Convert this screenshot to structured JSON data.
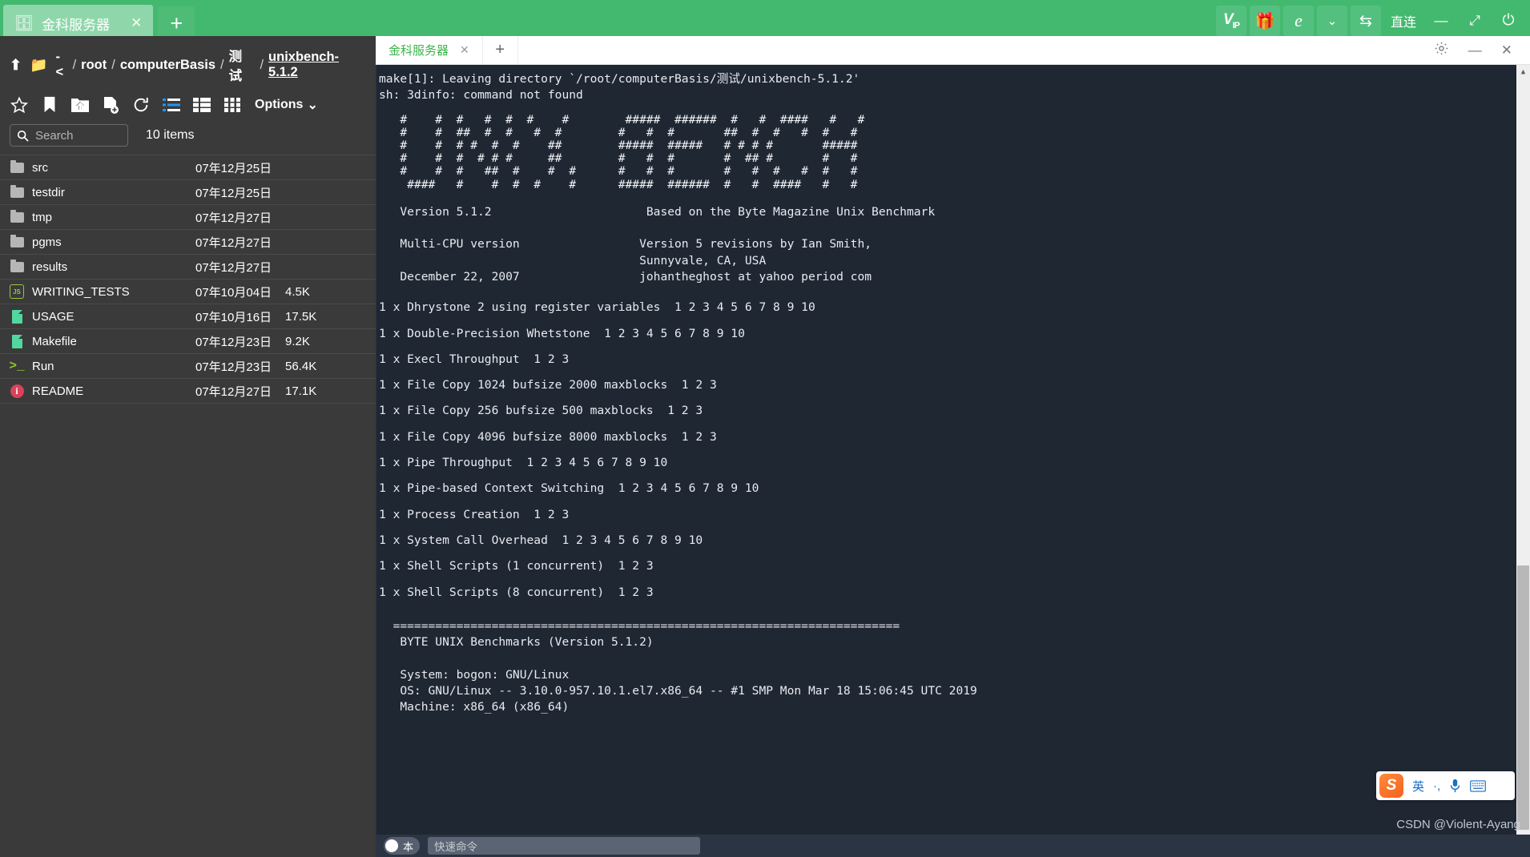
{
  "window": {
    "tab": {
      "label": "金科服务器",
      "icon": "server-icon",
      "close": "✕"
    },
    "new_tab": "+",
    "toolbar_right": [
      {
        "name": "vip-button",
        "label": "VIP"
      },
      {
        "name": "gift-button",
        "label": "🎁"
      },
      {
        "name": "ie-browser-button",
        "label": "e"
      },
      {
        "name": "chevron-down-button",
        "label": "⌄"
      },
      {
        "name": "transfer-button",
        "label": "⇆"
      },
      {
        "name": "direct-connect-button",
        "label": "直连"
      },
      {
        "name": "minimize-button",
        "label": "—"
      },
      {
        "name": "fullscreen-button",
        "label": "⤢"
      },
      {
        "name": "power-button",
        "label": "⏻"
      }
    ]
  },
  "filepane": {
    "path": {
      "up_icon": "⬆",
      "folder_icon": "📁",
      "crumbs": [
        "-<",
        "root",
        "computerBasis",
        "测试",
        "unixbench-5.1.2"
      ],
      "separator": "/"
    },
    "tools": [
      "star-icon",
      "bookmark-icon",
      "upload-folder-icon",
      "new-file-icon",
      "refresh-icon",
      "list-view-icon",
      "detail-view-icon",
      "grid-view-icon"
    ],
    "options_label": "Options",
    "options_caret": "⌄",
    "search": {
      "placeholder": "Search",
      "icon": "search-icon",
      "value": ""
    },
    "items_count": "10 items",
    "files": [
      {
        "icon": "folder",
        "name": "src",
        "date": "07年12月25日",
        "size": ""
      },
      {
        "icon": "folder",
        "name": "testdir",
        "date": "07年12月25日",
        "size": ""
      },
      {
        "icon": "folder",
        "name": "tmp",
        "date": "07年12月27日",
        "size": ""
      },
      {
        "icon": "folder",
        "name": "pgms",
        "date": "07年12月27日",
        "size": ""
      },
      {
        "icon": "folder",
        "name": "results",
        "date": "07年12月27日",
        "size": ""
      },
      {
        "icon": "js",
        "name": "WRITING_TESTS",
        "date": "07年10月04日",
        "size": "4.5K"
      },
      {
        "icon": "doc",
        "name": "USAGE",
        "date": "07年10月16日",
        "size": "17.5K"
      },
      {
        "icon": "doc",
        "name": "Makefile",
        "date": "07年12月23日",
        "size": "9.2K"
      },
      {
        "icon": "run",
        "name": "Run",
        "date": "07年12月23日",
        "size": "56.4K"
      },
      {
        "icon": "readme",
        "name": "README",
        "date": "07年12月27日",
        "size": "17.1K"
      }
    ]
  },
  "terminal": {
    "tab_label": "金科服务器",
    "tab_close": "✕",
    "new_tab": "+",
    "win_buttons": [
      {
        "name": "settings-gear-button",
        "label": "⚙"
      },
      {
        "name": "minimize-button",
        "label": "—"
      },
      {
        "name": "close-button",
        "label": "✕"
      }
    ],
    "header_lines": "make[1]: Leaving directory `/root/computerBasis/测试/unixbench-5.1.2'\nsh: 3dinfo: command not found",
    "ascii_art": "   #    #  #   #  #  #    #        #####  ######  #   #  ####   #   #\n   #    #  ##  #  #   #  #        #   #  #       ##  #  #   #  #   #\n   #    #  # #  #  #    ##        #####  #####   # # # #       #####\n   #    #  #  # # #     ##        #   #  #       #  ## #       #   #\n   #    #  #   ##  #    #  #      #   #  #       #   #  #   #  #   #\n    ####   #    #  #  #    #      #####  ######  #   #  ####   #   #",
    "version_block": "   Version 5.1.2                      Based on the Byte Magazine Unix Benchmark\n\n   Multi-CPU version                 Version 5 revisions by Ian Smith,\n                                     Sunnyvale, CA, USA\n   December 22, 2007                 johantheghost at yahoo period com",
    "test_lines": [
      "1 x Dhrystone 2 using register variables  1 2 3 4 5 6 7 8 9 10",
      "1 x Double-Precision Whetstone  1 2 3 4 5 6 7 8 9 10",
      "1 x Execl Throughput  1 2 3",
      "1 x File Copy 1024 bufsize 2000 maxblocks  1 2 3",
      "1 x File Copy 256 bufsize 500 maxblocks  1 2 3",
      "1 x File Copy 4096 bufsize 8000 maxblocks  1 2 3",
      "1 x Pipe Throughput  1 2 3 4 5 6 7 8 9 10",
      "1 x Pipe-based Context Switching  1 2 3 4 5 6 7 8 9 10",
      "1 x Process Creation  1 2 3",
      "1 x System Call Overhead  1 2 3 4 5 6 7 8 9 10",
      "1 x Shell Scripts (1 concurrent)  1 2 3",
      "1 x Shell Scripts (8 concurrent)  1 2 3"
    ],
    "footer_block": "  ========================================================================\n   BYTE UNIX Benchmarks (Version 5.1.2)\n\n   System: bogon: GNU/Linux\n   OS: GNU/Linux -- 3.10.0-957.10.1.el7.x86_64 -- #1 SMP Mon Mar 18 15:06:45 UTC 2019\n   Machine: x86_64 (x86_64)",
    "scrollbar": {
      "up": "▲",
      "down": "▼"
    }
  },
  "cmdbar": {
    "ime_label": "本",
    "placeholder": "快速命令",
    "value": ""
  },
  "ime_bar": {
    "logo": "S",
    "mode": "英",
    "punctuation": "·,",
    "mic_icon": "🎤",
    "keyboard_icon": "⌨",
    "apps_icon": "apps-grid-icon"
  },
  "watermark": "CSDN @Violent-Ayang",
  "colors": {
    "accent_green": "#43b96f",
    "tab_green": "#8fd7aa",
    "terminal_bg": "#1f2733",
    "filepane_bg": "#3a3a3a",
    "ime_blue": "#1a6fc4"
  }
}
